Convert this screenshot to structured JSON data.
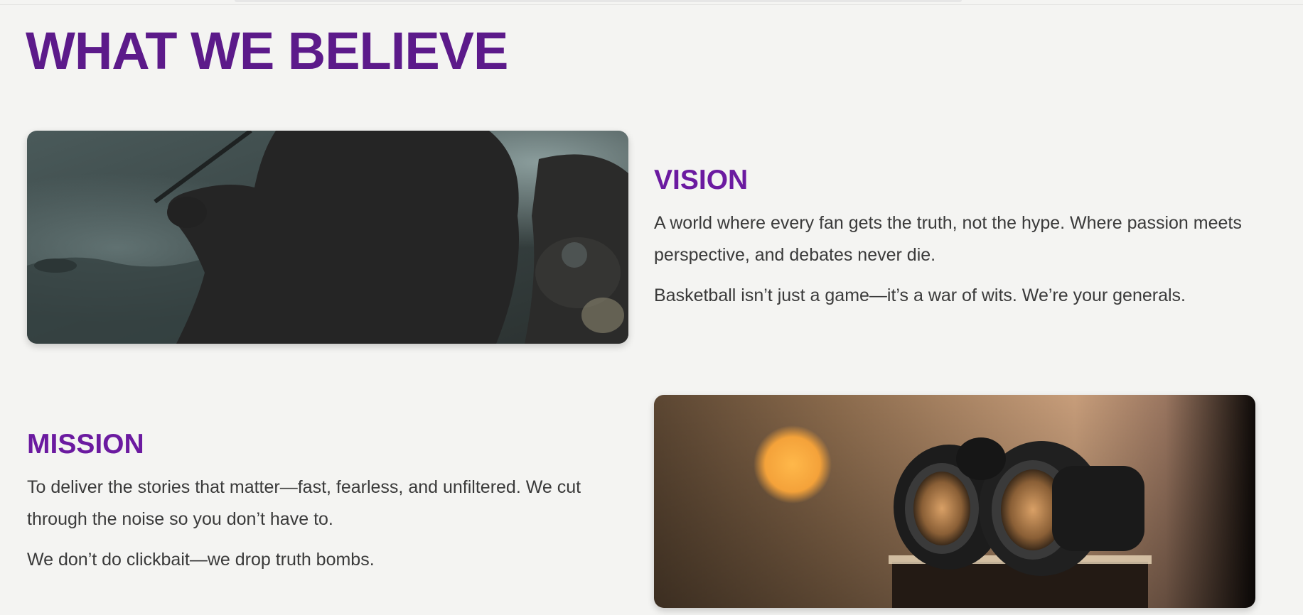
{
  "page": {
    "title": "WHAT WE BELIEVE"
  },
  "vision": {
    "heading": "VISION",
    "paragraphs": [
      "A world where every fan gets the truth, not the hype. Where passion meets perspective, and debates never die.",
      "Basketball isn’t just a game—it’s a war of wits. We’re your generals."
    ],
    "image_icon": "archer-silhouette-photo"
  },
  "mission": {
    "heading": "MISSION",
    "paragraphs": [
      "To deliver the stories that matter—fast, fearless, and unfiltered. We cut through the noise so you don’t have to.",
      "We don’t do clickbait—we drop truth bombs."
    ],
    "image_icon": "binoculars-photo"
  },
  "colors": {
    "background": "#f4f4f2",
    "title": "#5c1a8a",
    "heading": "#6b1aa0",
    "body_text": "#3a3a3a"
  }
}
